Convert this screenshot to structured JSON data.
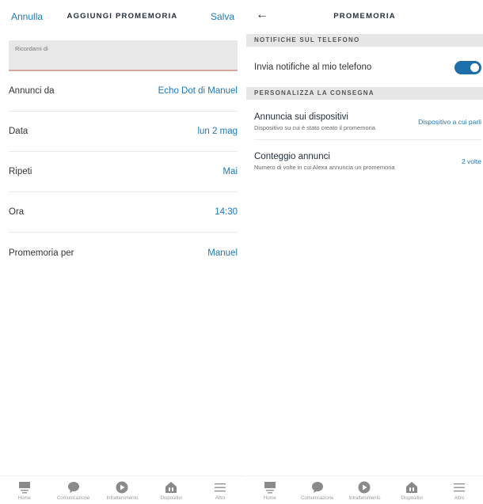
{
  "left": {
    "header": {
      "cancel_label": "Annulla",
      "title": "AGGIUNGI PROMEMORIA",
      "save_label": "Salva"
    },
    "reminder_field": {
      "label": "Ricordami di",
      "value": ""
    },
    "rows": [
      {
        "label": "Annunci da",
        "value": "Echo Dot di Manuel"
      },
      {
        "label": "Data",
        "value": "lun 2 mag"
      },
      {
        "label": "Ripeti",
        "value": "Mai"
      },
      {
        "label": "Ora",
        "value": "14:30"
      },
      {
        "label": "Promemoria per",
        "value": "Manuel"
      }
    ]
  },
  "right": {
    "header": {
      "back_icon": "arrow-left-icon",
      "title": "PROMEMORIA"
    },
    "section_phone": "NOTIFICHE SUL TELEFONO",
    "phone_notifications": {
      "label": "Invia notifiche al mio telefono",
      "enabled": true,
      "accent_color": "#1d6fa9"
    },
    "section_delivery": "PERSONALIZZA LA CONSEGNA",
    "delivery_rows": [
      {
        "title": "Annuncia sui dispositivi",
        "subtitle": "Dispositivo su cui è stato creato il promemoria",
        "value": "Dispositivo a cui parli"
      },
      {
        "title": "Conteggio annunci",
        "subtitle": "Numero di volte in cui Alexa annuncia un promemoria",
        "value": "2 volte"
      }
    ]
  },
  "nav": [
    {
      "label": "Home",
      "icon": "home-icon"
    },
    {
      "label": "Comunicazione",
      "icon": "chat-bubble-icon"
    },
    {
      "label": "Intrattenimento",
      "icon": "play-icon"
    },
    {
      "label": "Dispositivi",
      "icon": "devices-house-icon"
    },
    {
      "label": "Altro",
      "icon": "menu-icon"
    }
  ],
  "colors": {
    "link": "#1d79b5",
    "toggle_on": "#1d6fa9",
    "section_bg": "#e6e6e6"
  }
}
